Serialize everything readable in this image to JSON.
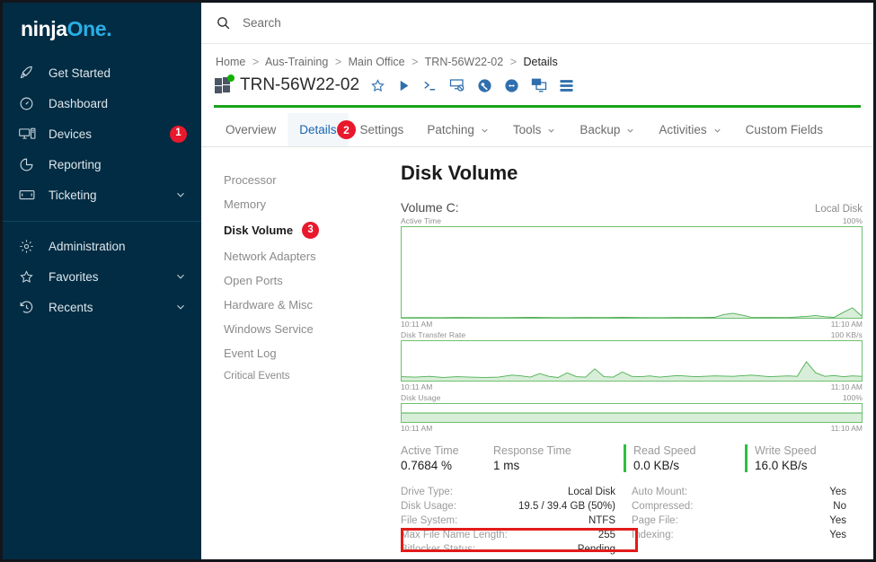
{
  "brand": {
    "part1": "ninja",
    "part2": "One",
    "dot": "."
  },
  "sidebar": {
    "items": [
      {
        "label": "Get Started",
        "icon": "rocket-icon",
        "badge": null,
        "chevron": false
      },
      {
        "label": "Dashboard",
        "icon": "gauge-icon",
        "badge": null,
        "chevron": false
      },
      {
        "label": "Devices",
        "icon": "devices-icon",
        "badge": "1",
        "chevron": false
      },
      {
        "label": "Reporting",
        "icon": "pie-chart-icon",
        "badge": null,
        "chevron": false
      },
      {
        "label": "Ticketing",
        "icon": "ticket-icon",
        "badge": null,
        "chevron": true
      }
    ],
    "items2": [
      {
        "label": "Administration",
        "icon": "gear-icon",
        "badge": null,
        "chevron": false
      },
      {
        "label": "Favorites",
        "icon": "star-icon",
        "badge": null,
        "chevron": true
      },
      {
        "label": "Recents",
        "icon": "history-icon",
        "badge": null,
        "chevron": true
      }
    ]
  },
  "search": {
    "placeholder": "Search",
    "value": ""
  },
  "breadcrumb": {
    "items": [
      "Home",
      "Aus-Training",
      "Main Office",
      "TRN-56W22-02",
      "Details"
    ],
    "separator": ">"
  },
  "device": {
    "name": "TRN-56W22-02",
    "status": "online",
    "actions": [
      "favorite-star-icon",
      "run-script-icon",
      "terminal-icon",
      "remote-desktop-icon",
      "splashtop-icon",
      "teamviewer-icon",
      "screen-share-icon",
      "device-list-icon"
    ]
  },
  "tabs": [
    {
      "label": "Overview",
      "active": false,
      "chevron": false
    },
    {
      "label": "Details",
      "active": true,
      "chevron": false
    },
    {
      "label": "Settings",
      "active": false,
      "chevron": false
    },
    {
      "label": "Patching",
      "active": false,
      "chevron": true
    },
    {
      "label": "Tools",
      "active": false,
      "chevron": true
    },
    {
      "label": "Backup",
      "active": false,
      "chevron": true
    },
    {
      "label": "Activities",
      "active": false,
      "chevron": true
    },
    {
      "label": "Custom Fields",
      "active": false,
      "chevron": false
    }
  ],
  "tab_badge": "2",
  "subnav": {
    "items": [
      {
        "label": "Processor",
        "active": false,
        "badge": null
      },
      {
        "label": "Memory",
        "active": false,
        "badge": null
      },
      {
        "label": "Disk Volume",
        "active": true,
        "badge": "3"
      },
      {
        "label": "Network Adapters",
        "active": false,
        "badge": null
      },
      {
        "label": "Open Ports",
        "active": false,
        "badge": null
      },
      {
        "label": "Hardware & Misc",
        "active": false,
        "badge": null
      },
      {
        "label": "Windows Service",
        "active": false,
        "badge": null
      },
      {
        "label": "Event Log",
        "active": false,
        "badge": null
      },
      {
        "label": "Critical Events",
        "active": false,
        "badge": null,
        "small": true
      }
    ]
  },
  "panel": {
    "title": "Disk Volume",
    "volume_label": "Volume C:",
    "volume_type": "Local Disk"
  },
  "metrics": [
    {
      "label": "Active Time",
      "value": "0.7684 %",
      "accent": false
    },
    {
      "label": "Response Time",
      "value": "1 ms",
      "accent": false
    },
    {
      "label": "Read Speed",
      "value": "0.0 KB/s",
      "accent": true
    },
    {
      "label": "Write Speed",
      "value": "16.0 KB/s",
      "accent": true
    }
  ],
  "info_left": [
    {
      "key": "Drive Type:",
      "value": "Local Disk"
    },
    {
      "key": "Disk Usage:",
      "value": "19.5 / 39.4 GB (50%)"
    },
    {
      "key": "File System:",
      "value": "NTFS"
    },
    {
      "key": "Max File Name Length:",
      "value": "255"
    },
    {
      "key": "Bitlocker Status:",
      "value": "Pending"
    }
  ],
  "info_right": [
    {
      "key": "Auto Mount:",
      "value": "Yes"
    },
    {
      "key": "Compressed:",
      "value": "No"
    },
    {
      "key": "Page File:",
      "value": "Yes"
    },
    {
      "key": "Indexing:",
      "value": "Yes"
    }
  ],
  "colors": {
    "sidebar_bg": "#022c43",
    "brand_accent": "#2aaee6",
    "badge_red": "#e8192c",
    "chart_green": "#6ec071",
    "status_green": "#19a319",
    "tab_active": "#1666b0",
    "highlight_red": "#e31b1b"
  },
  "chart_data": [
    {
      "type": "area",
      "title": "Active Time",
      "ylabel": "Active Time",
      "ymax_label": "100%",
      "ylim": [
        0,
        100
      ],
      "xlabel": "",
      "xticks": [
        "10:11 AM",
        "11:10 AM"
      ],
      "grid": false,
      "legend": "none",
      "x": [
        0,
        4,
        8,
        12,
        16,
        20,
        24,
        28,
        32,
        36,
        40,
        44,
        48,
        52,
        56,
        60,
        64,
        68,
        70,
        72,
        74,
        76,
        80,
        84,
        88,
        90,
        92,
        94,
        96,
        98,
        100
      ],
      "values": [
        0.2,
        0.3,
        0.2,
        0.4,
        0.3,
        0.2,
        0.3,
        0.5,
        0.3,
        0.2,
        0.4,
        0.3,
        0.5,
        0.3,
        0.2,
        0.4,
        0.3,
        0.5,
        3.5,
        5.0,
        3.0,
        0.6,
        0.4,
        0.3,
        1.5,
        2.5,
        1.2,
        0.5,
        6.0,
        11.0,
        2.0
      ]
    },
    {
      "type": "area",
      "title": "Disk Transfer Rate",
      "ylabel": "Disk Transfer Rate",
      "ymax_label": "100 KB/s",
      "ylim": [
        0,
        100
      ],
      "xlabel": "",
      "xticks": [
        "10:11 AM",
        "11:10 AM"
      ],
      "grid": false,
      "legend": "none",
      "x": [
        0,
        3,
        6,
        9,
        12,
        15,
        18,
        21,
        24,
        26,
        28,
        30,
        32,
        34,
        36,
        38,
        40,
        42,
        44,
        46,
        48,
        50,
        52,
        54,
        56,
        58,
        60,
        64,
        68,
        72,
        76,
        80,
        84,
        86,
        88,
        90,
        92,
        94,
        96,
        98,
        100
      ],
      "values": [
        10,
        9,
        11,
        8,
        10,
        9,
        8,
        9,
        14,
        12,
        9,
        18,
        11,
        8,
        20,
        10,
        9,
        30,
        10,
        9,
        22,
        11,
        10,
        12,
        9,
        11,
        13,
        10,
        12,
        11,
        14,
        10,
        12,
        11,
        48,
        20,
        11,
        13,
        10,
        12,
        11
      ]
    },
    {
      "type": "area",
      "title": "Disk Usage",
      "ylabel": "Disk Usage",
      "ymax_label": "100%",
      "ylim": [
        0,
        100
      ],
      "xlabel": "",
      "xticks": [
        "10:11 AM",
        "11:10 AM"
      ],
      "grid": false,
      "legend": "none",
      "x": [
        0,
        50,
        100
      ],
      "values": [
        50,
        50,
        50
      ]
    }
  ]
}
